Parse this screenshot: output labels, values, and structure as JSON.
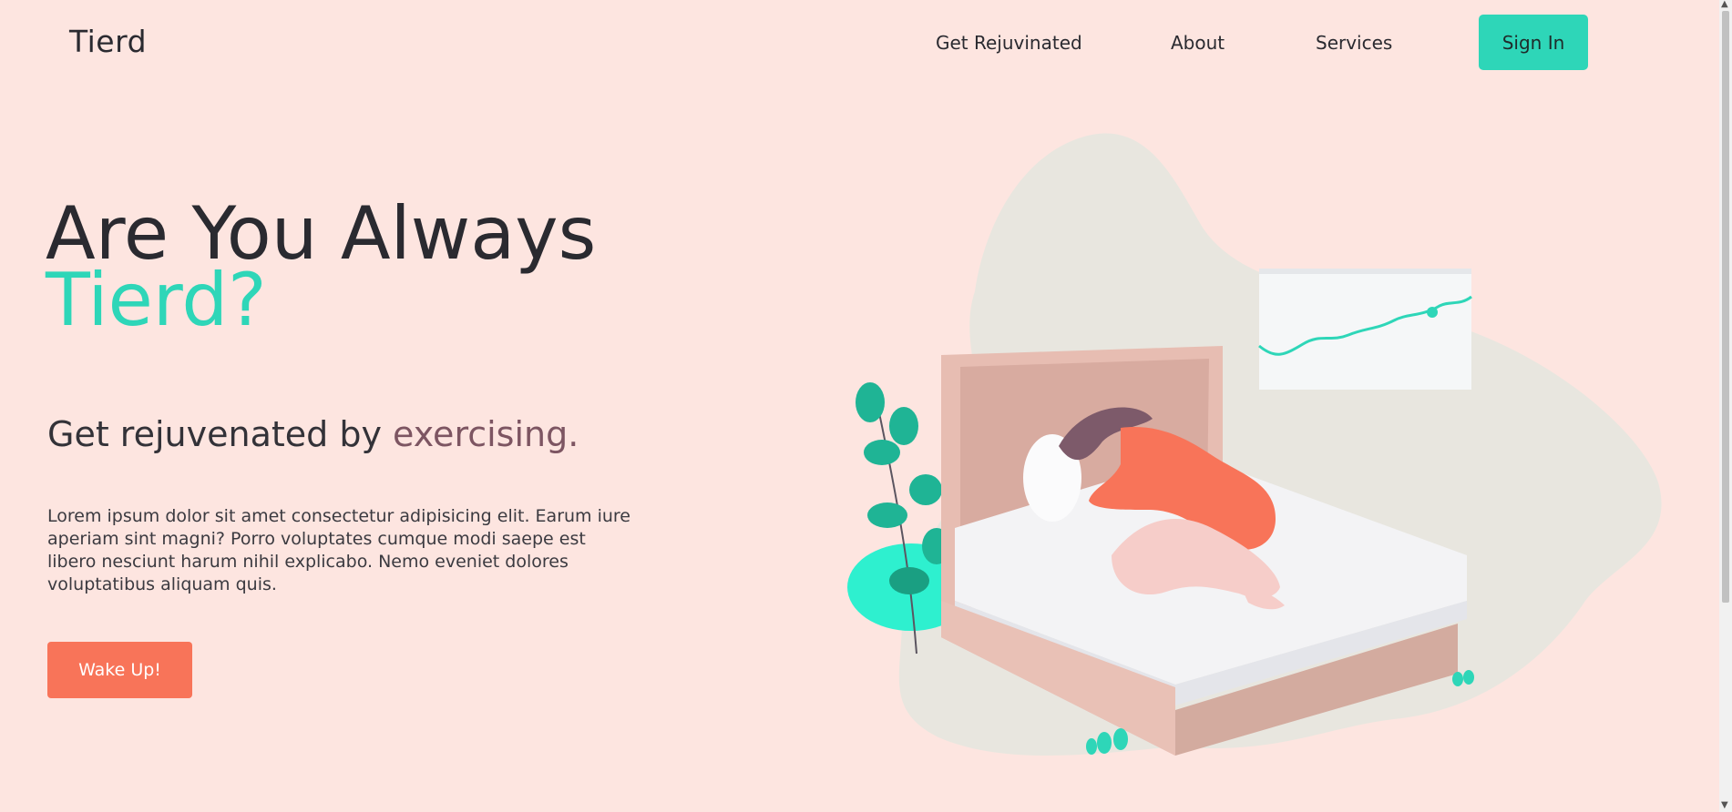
{
  "header": {
    "logo": "Tierd",
    "nav": [
      {
        "label": "Get Rejuvinated"
      },
      {
        "label": "About"
      },
      {
        "label": "Services"
      }
    ],
    "signin_label": "Sign In"
  },
  "hero": {
    "title_line1": "Are You Always",
    "title_line2": "Tierd?",
    "subtitle_main": "Get rejuvenated by ",
    "subtitle_accent": "exercising.",
    "paragraph": "Lorem ipsum dolor sit amet consectetur adipisicing elit. Earum iure aperiam sint magni? Porro voluptates cumque modi saepe est libero nesciunt harum nihil explicabo. Nemo eveniet dolores voluptatibus aliquam quis.",
    "cta_label": "Wake Up!"
  },
  "colors": {
    "background": "#fde5e0",
    "accent": "#2ed6b8",
    "secondary": "#7d5562",
    "cta": "#f87459"
  },
  "icons": {
    "illustration": "tired-woman-on-bed-illustration"
  }
}
